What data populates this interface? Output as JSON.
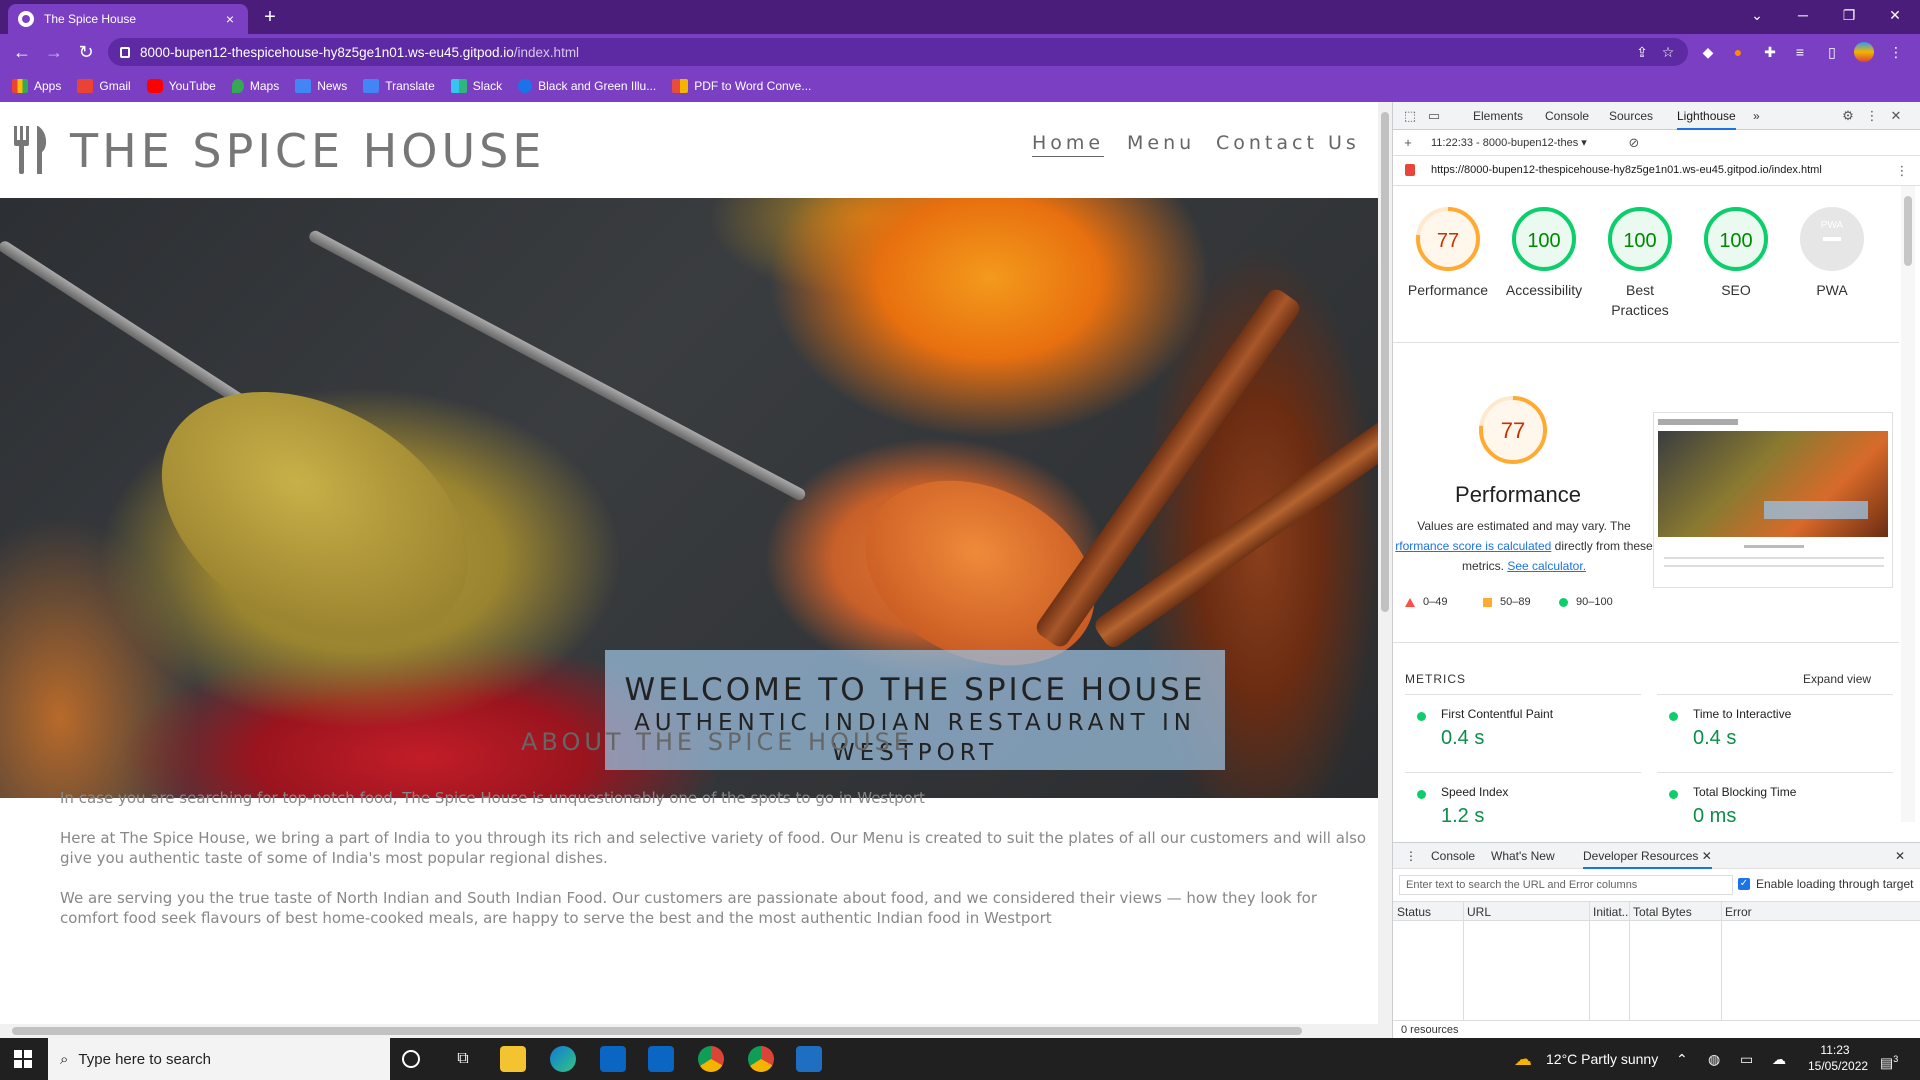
{
  "browser": {
    "tab_title": "The Spice House",
    "tab_close": "×",
    "new_tab": "+",
    "url_host": "8000-bupen12-thespicehouse-hy8z5ge1n01.ws-eu45.gitpod.io",
    "url_path": "/index.html",
    "bookmarks": [
      {
        "label": "Apps",
        "color": "#e8453c"
      },
      {
        "label": "Gmail",
        "color": "#ea4335"
      },
      {
        "label": "YouTube",
        "color": "#ff0000"
      },
      {
        "label": "Maps",
        "color": "#34a853"
      },
      {
        "label": "News",
        "color": "#4285f4"
      },
      {
        "label": "Translate",
        "color": "#4285f4"
      },
      {
        "label": "Slack",
        "color": "#36c5f0"
      },
      {
        "label": "Black and Green Illu...",
        "color": "#1a73e8"
      },
      {
        "label": "PDF to Word Conve...",
        "color": "#e84c3d"
      }
    ]
  },
  "site": {
    "logo_text": "THE SPICE HOUSE",
    "nav": {
      "home": "Home",
      "menu": "Menu",
      "contact": "Contact Us"
    },
    "hero_title": "WELCOME TO THE SPICE HOUSE",
    "hero_sub_1": "AUTHENTIC INDIAN RESTAURANT IN",
    "hero_sub_2": "WESTPORT",
    "about_title": "ABOUT THE SPICE HOUSE",
    "about_p1": "In case you are searching for top-notch food, The Spice House is unquestionably one of the spots to go in Westport",
    "about_p2": "Here at The Spice House, we bring a part of India to you through its rich and selective variety of food. Our Menu is created to suit the plates of all our customers and will also give you authentic taste of some of India's most popular regional dishes.",
    "about_p3": "We are serving you the true taste of North Indian and South Indian Food. Our customers are passionate about food, and we considered their views — how they look for comfort food seek flavours of best home-cooked meals, are happy to serve the best and the most authentic Indian food in Westport"
  },
  "devtools": {
    "tabs": [
      "Elements",
      "Console",
      "Sources",
      "Lighthouse"
    ],
    "more": "»",
    "report_select": "11:22:33 - 8000-bupen12-thes ▾",
    "report_url": "https://8000-bupen12-thespicehouse-hy8z5ge1n01.ws-eu45.gitpod.io/index.html",
    "scores": [
      {
        "value": "77",
        "label": "Performance",
        "score": 0.77,
        "color": "#fa3"
      },
      {
        "value": "100",
        "label": "Accessibility",
        "score": 1.0,
        "color": "#0cce6b"
      },
      {
        "value": "100",
        "label": "Best Practices",
        "score": 1.0,
        "color": "#0cce6b"
      },
      {
        "value": "100",
        "label": "SEO",
        "score": 1.0,
        "color": "#0cce6b"
      },
      {
        "value": "PWA",
        "label": "PWA",
        "score": 0,
        "color": "#bbb"
      }
    ],
    "perf_score": "77",
    "perf_title": "Performance",
    "perf_desc_1": "Values are estimated and may vary. The",
    "perf_desc_link": "rformance score is calculated",
    "perf_desc_2": " directly from these",
    "perf_desc_3": "metrics. ",
    "perf_desc_link2": "See calculator.",
    "legend": [
      "0–49",
      "50–89",
      "90–100"
    ],
    "metrics_heading": "METRICS",
    "expand_view": "Expand view",
    "metrics": [
      {
        "label": "First Contentful Paint",
        "value": "0.4 s"
      },
      {
        "label": "Time to Interactive",
        "value": "0.4 s"
      },
      {
        "label": "Speed Index",
        "value": "1.2 s"
      },
      {
        "label": "Total Blocking Time",
        "value": "0 ms"
      }
    ],
    "drawer_tabs": [
      "Console",
      "What's New",
      "Developer Resources"
    ],
    "filter_placeholder": "Enter text to search the URL and Error columns",
    "enable_loading": "Enable loading through target",
    "columns": [
      "Status",
      "URL",
      "Initiat..",
      "Total Bytes",
      "Error"
    ],
    "resources_count": "0 resources"
  },
  "taskbar": {
    "search_placeholder": "Type here to search",
    "weather": "12°C  Partly sunny",
    "time": "11:23",
    "date": "15/05/2022",
    "notif_count": "3"
  }
}
